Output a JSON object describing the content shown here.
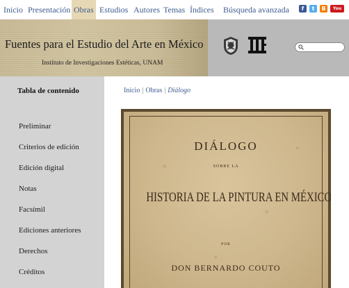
{
  "nav": {
    "items": [
      "Inicio",
      "Presentación",
      "Obras",
      "Estudios",
      "Autores",
      "Temas",
      "Índices"
    ],
    "active": "Obras",
    "advanced_search": "Búsqueda avanzada"
  },
  "social": [
    {
      "name": "facebook-icon",
      "glyph": "f",
      "color": "#3b5998"
    },
    {
      "name": "twitter-icon",
      "glyph": "t",
      "color": "#55acee"
    },
    {
      "name": "blogger-icon",
      "glyph": "B",
      "color": "#f57d00"
    },
    {
      "name": "youtube-icon",
      "glyph": "You",
      "color": "#cc181e"
    }
  ],
  "header": {
    "title": "Fuentes para el Estudio del Arte en México",
    "subtitle": "Instituto de Investigaciones Estéticas, UNAM"
  },
  "search": {
    "placeholder": ""
  },
  "sidebar": {
    "title": "Tabla de contenido",
    "items": [
      "Preliminar",
      "Criterios de edición",
      "Edición digital",
      "Notas",
      "Facsímil",
      "Ediciones anteriores",
      "Derechos",
      "Créditos"
    ]
  },
  "breadcrumb": {
    "items": [
      "Inicio",
      "Obras"
    ],
    "current": "Diálogo"
  },
  "scan": {
    "title": "DIÁLOGO",
    "sobre": "SOBRE LA",
    "main": "HISTORIA DE LA PINTURA EN MÉXICO",
    "por": "POR",
    "author": "DON BERNARDO COUTO"
  }
}
